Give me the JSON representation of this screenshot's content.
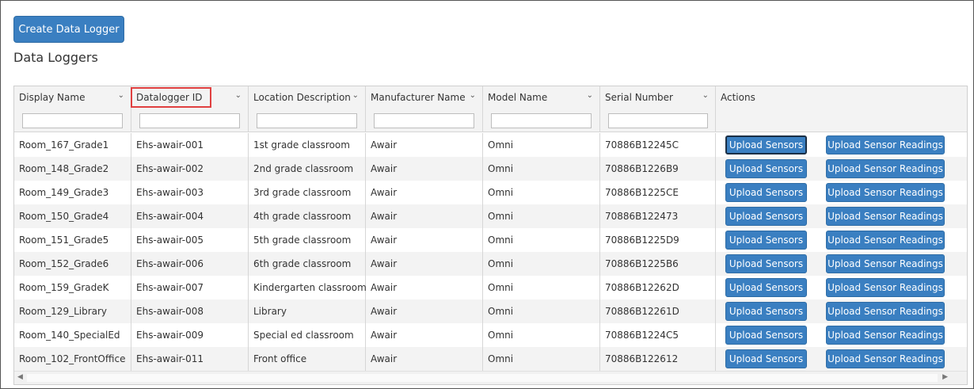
{
  "toolbar": {
    "create_label": "Create Data Logger"
  },
  "page": {
    "title": "Data Loggers"
  },
  "columns": [
    {
      "label": "Display Name"
    },
    {
      "label": "Datalogger ID"
    },
    {
      "label": "Location Description"
    },
    {
      "label": "Manufacturer Name"
    },
    {
      "label": "Model Name"
    },
    {
      "label": "Serial Number"
    },
    {
      "label": "Actions"
    }
  ],
  "actions": {
    "upload_sensors": "Upload Sensors",
    "upload_readings": "Upload Sensor Readings"
  },
  "rows": [
    {
      "display_name": "Room_167_Grade1",
      "id": "Ehs-awair-001",
      "location": "1st grade classroom",
      "manufacturer": "Awair",
      "model": "Omni",
      "serial": "70886B12245C"
    },
    {
      "display_name": "Room_148_Grade2",
      "id": "Ehs-awair-002",
      "location": "2nd grade classroom",
      "manufacturer": "Awair",
      "model": "Omni",
      "serial": "70886B1226B9"
    },
    {
      "display_name": "Room_149_Grade3",
      "id": "Ehs-awair-003",
      "location": "3rd grade classroom",
      "manufacturer": "Awair",
      "model": "Omni",
      "serial": "70886B1225CE"
    },
    {
      "display_name": "Room_150_Grade4",
      "id": "Ehs-awair-004",
      "location": "4th grade classroom",
      "manufacturer": "Awair",
      "model": "Omni",
      "serial": "70886B122473"
    },
    {
      "display_name": "Room_151_Grade5",
      "id": "Ehs-awair-005",
      "location": "5th grade classroom",
      "manufacturer": "Awair",
      "model": "Omni",
      "serial": "70886B1225D9"
    },
    {
      "display_name": "Room_152_Grade6",
      "id": "Ehs-awair-006",
      "location": "6th grade classroom",
      "manufacturer": "Awair",
      "model": "Omni",
      "serial": "70886B1225B6"
    },
    {
      "display_name": "Room_159_GradeK",
      "id": "Ehs-awair-007",
      "location": "Kindergarten classroom",
      "manufacturer": "Awair",
      "model": "Omni",
      "serial": "70886B12262D"
    },
    {
      "display_name": "Room_129_Library",
      "id": "Ehs-awair-008",
      "location": "Library",
      "manufacturer": "Awair",
      "model": "Omni",
      "serial": "70886B12261D"
    },
    {
      "display_name": "Room_140_SpecialEd",
      "id": "Ehs-awair-009",
      "location": "Special ed classroom",
      "manufacturer": "Awair",
      "model": "Omni",
      "serial": "70886B1224C5"
    },
    {
      "display_name": "Room_102_FrontOffice",
      "id": "Ehs-awair-011",
      "location": "Front office",
      "manufacturer": "Awair",
      "model": "Omni",
      "serial": "70886B122612"
    }
  ],
  "icons": {
    "sort": "chevron-down-icon",
    "scroll_left": "scroll-left-icon",
    "scroll_right": "scroll-right-icon"
  },
  "colors": {
    "accent": "#3a7fc1",
    "highlight": "#e04040"
  }
}
